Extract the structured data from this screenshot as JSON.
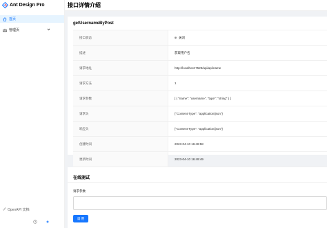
{
  "app": {
    "title": "Ant Design Pro",
    "brand_color": "#1677ff"
  },
  "sidebar": {
    "items": [
      {
        "label": "首页",
        "icon": "home-icon",
        "active": true
      },
      {
        "label": "管理页",
        "icon": "crown-icon",
        "expandable": true
      }
    ],
    "footer_link": {
      "label": "OpenAPI 文档",
      "icon": "link-icon"
    },
    "bottom_icons": [
      "question-icon",
      "sparkle-icon"
    ]
  },
  "header": {
    "title": "接口详情介绍"
  },
  "detail": {
    "title": "getUsernameByPost",
    "rows": [
      {
        "label": "接口状态",
        "value": "关闭",
        "status_dot": "#999999"
      },
      {
        "label": "描述",
        "value": "获取用户名"
      },
      {
        "label": "请求地址",
        "value": "http://localhost:7529/api/api/name"
      },
      {
        "label": "请求方法",
        "value": "1"
      },
      {
        "label": "请求参数",
        "value": "[ { \"name\": \"username\", \"type\": \"string\" } ]"
      },
      {
        "label": "请求头",
        "value": "{\"Content-Type\": \"application/json\"}"
      },
      {
        "label": "响应头",
        "value": "{\"Content-Type\": \"application/json\"}"
      },
      {
        "label": "创建时间",
        "value": "2023-04-10 16:48:58"
      },
      {
        "label": "更新时间",
        "value": "2023-04-10 16:49:49"
      }
    ]
  },
  "online_test": {
    "title": "在线测试",
    "params_label": "请求参数",
    "params_value": "",
    "call_button": "调 用"
  }
}
